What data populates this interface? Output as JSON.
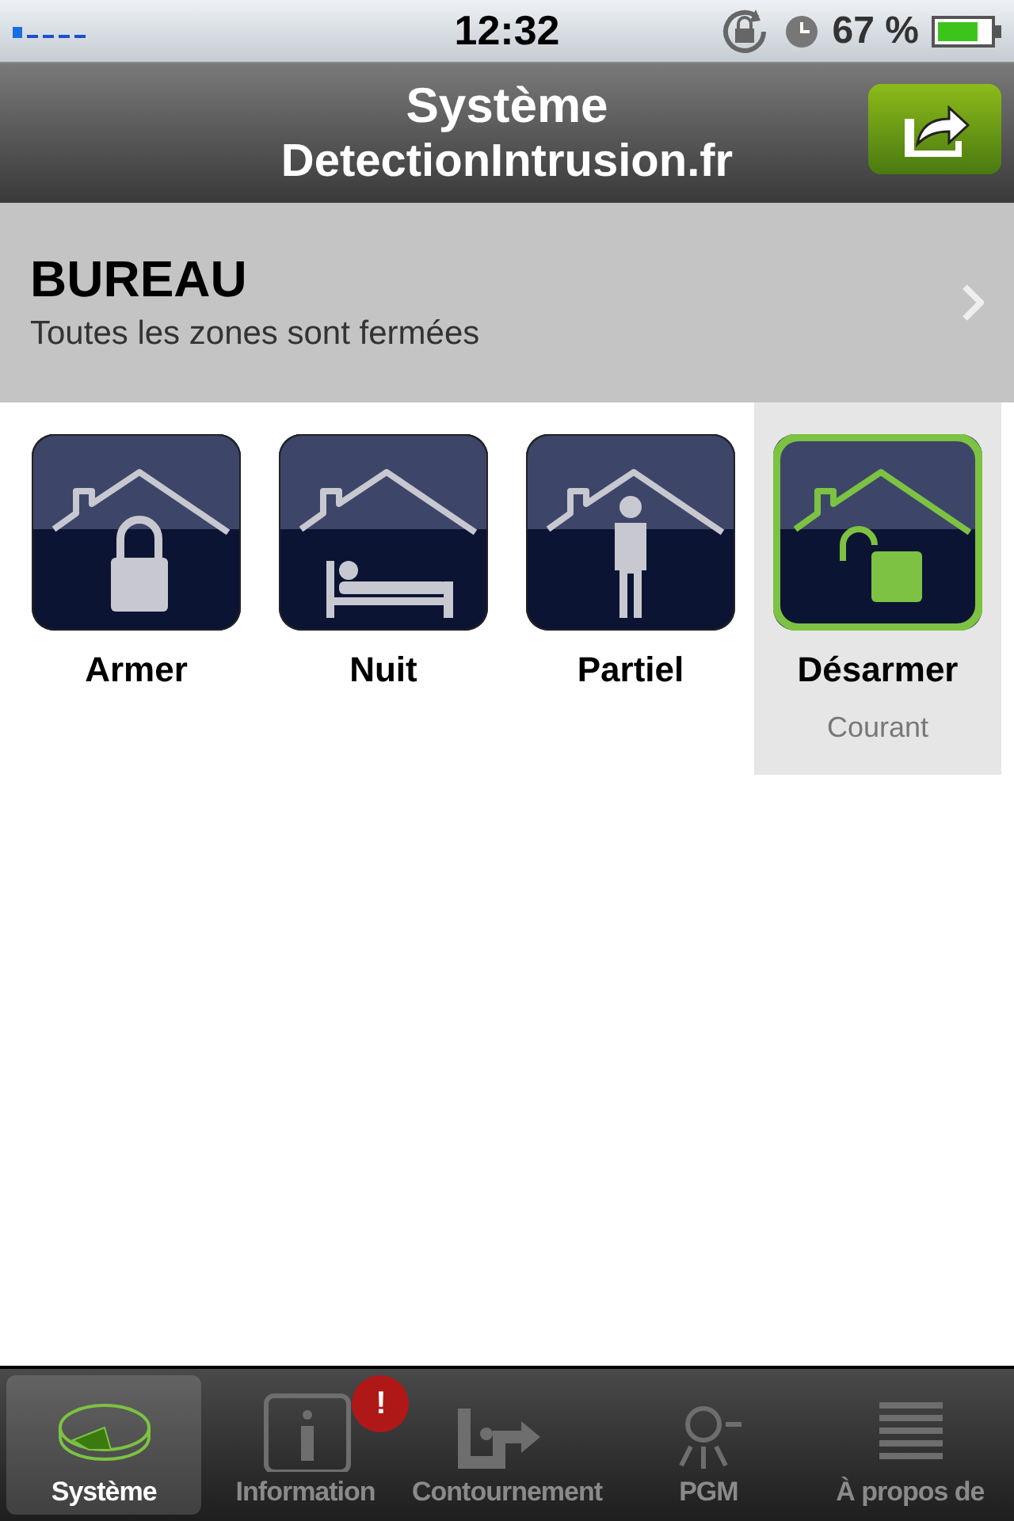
{
  "status_bar": {
    "time": "12:32",
    "battery_text": "67 %"
  },
  "nav_bar": {
    "title": "Système",
    "subtitle": "DetectionIntrusion.fr"
  },
  "section": {
    "title": "BUREAU",
    "subtitle": "Toutes les zones sont fermées"
  },
  "modes": [
    {
      "label": "Armer",
      "kind": "lock",
      "selected": false
    },
    {
      "label": "Nuit",
      "kind": "bed",
      "selected": false
    },
    {
      "label": "Partiel",
      "kind": "person",
      "selected": false
    },
    {
      "label": "Désarmer",
      "kind": "unlock",
      "selected": true,
      "note": "Courant"
    }
  ],
  "tab_bar": [
    {
      "label": "Système",
      "kind": "system",
      "selected": true
    },
    {
      "label": "Information",
      "kind": "info",
      "selected": false,
      "badge": "!"
    },
    {
      "label": "Contournement",
      "kind": "bypass",
      "selected": false
    },
    {
      "label": "PGM",
      "kind": "bulb",
      "selected": false
    },
    {
      "label": "À propos de",
      "kind": "list",
      "selected": false
    }
  ]
}
